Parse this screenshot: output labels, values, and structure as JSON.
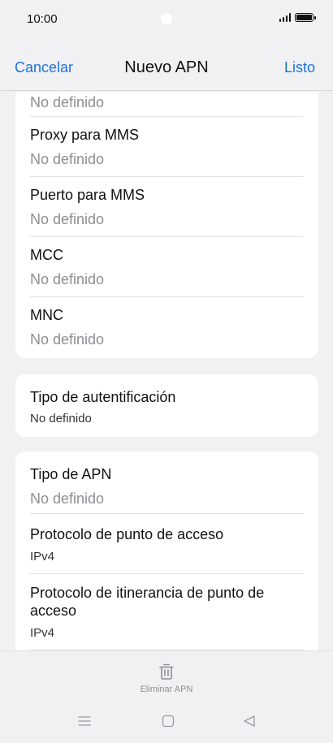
{
  "status_bar": {
    "time": "10:00"
  },
  "header": {
    "cancel_label": "Cancelar",
    "title": "Nuevo APN",
    "done_label": "Listo"
  },
  "card1": {
    "top_value": "No definido",
    "rows": [
      {
        "label": "Proxy para MMS",
        "value": "No definido"
      },
      {
        "label": "Puerto para MMS",
        "value": "No definido"
      },
      {
        "label": "MCC",
        "value": "No definido"
      },
      {
        "label": "MNC",
        "value": "No definido"
      }
    ]
  },
  "card2": {
    "label": "Tipo de autentificación",
    "value": "No definido"
  },
  "card3": {
    "rows": [
      {
        "label": "Tipo de APN",
        "value": "No definido"
      },
      {
        "label": "Protocolo de punto de acceso",
        "value": "IPv4"
      },
      {
        "label": "Protocolo de itinerancia de punto de acceso",
        "value": "IPv4"
      }
    ]
  },
  "bottom": {
    "delete_label": "Eliminar APN"
  },
  "colors": {
    "accent": "#1a73d9",
    "background": "#f1f1f3",
    "secondary_text": "#8e8e93"
  }
}
